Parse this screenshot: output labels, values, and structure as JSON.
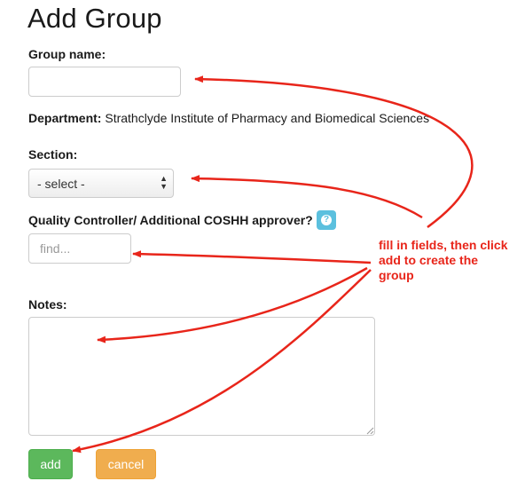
{
  "page": {
    "title": "Add Group"
  },
  "group_name": {
    "label": "Group name:",
    "value": "",
    "placeholder": ""
  },
  "department": {
    "label": "Department:",
    "value": "Strathclyde Institute of Pharmacy and Biomedical Sciences"
  },
  "section": {
    "label": "Section:",
    "selected": "- select -"
  },
  "quality_controller": {
    "label": "Quality Controller/ Additional COSHH approver?",
    "placeholder": "find..."
  },
  "notes": {
    "label": "Notes:",
    "value": ""
  },
  "buttons": {
    "add": "add",
    "cancel": "cancel"
  },
  "annotation": {
    "text": "fill in fields, then click add to create the group",
    "color": "#e8251a"
  },
  "icons": {
    "help": "question-circle-icon",
    "select_arrows": "up-down-caret-icon"
  },
  "colors": {
    "add_button": "#5cb85c",
    "cancel_button": "#f0ad4e",
    "help_badge": "#5bc0de"
  }
}
